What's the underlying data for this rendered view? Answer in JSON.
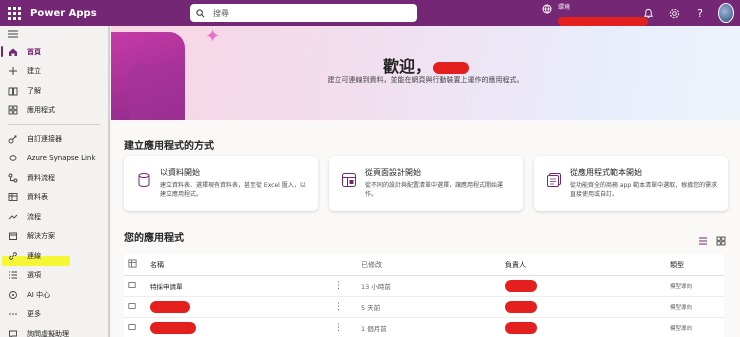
{
  "topbar": {
    "brand": "Power Apps",
    "search_placeholder": "搜尋",
    "environment_label": "環境"
  },
  "sidebar": {
    "items": [
      {
        "label": "首頁",
        "icon": "home-icon",
        "active": true
      },
      {
        "label": "建立",
        "icon": "plus-icon"
      },
      {
        "label": "了解",
        "icon": "book-icon"
      },
      {
        "label": "應用程式",
        "icon": "apps-icon"
      },
      {
        "label": "自訂連接器",
        "icon": "connector-icon"
      },
      {
        "label": "Azure Synapse Link",
        "icon": "synapse-icon"
      },
      {
        "label": "資料流程",
        "icon": "dataflow-icon"
      },
      {
        "label": "資料表",
        "icon": "table-icon"
      },
      {
        "label": "流程",
        "icon": "flow-icon"
      },
      {
        "label": "解決方案",
        "icon": "solution-icon"
      },
      {
        "label": "連線",
        "icon": "link-icon"
      },
      {
        "label": "選項",
        "icon": "options-icon"
      },
      {
        "label": "AI 中心",
        "icon": "ai-icon"
      },
      {
        "label": "更多",
        "icon": "more-icon"
      },
      {
        "label": "詢問虛擬助理",
        "icon": "chat-icon"
      }
    ]
  },
  "hero": {
    "title": "歡迎，",
    "subtitle": "建立可連線到資料，並能在網頁與行動裝置上運作的應用程式。"
  },
  "build": {
    "title": "建立應用程式的方式",
    "cards": [
      {
        "title": "以資料開始",
        "desc": "建立資料表、選擇現有資料表，甚至從 Excel 匯入，以建立應用程式。"
      },
      {
        "title": "從頁面設計開始",
        "desc": "從不同的設計與配置清單中選擇，讓應用程式開始運作。"
      },
      {
        "title": "從應用程式範本開始",
        "desc": "從功能齊全的商務 app 範本清單中選取，根據您的需求直接使用或自訂。"
      }
    ]
  },
  "apps": {
    "title": "您的應用程式",
    "columns": [
      "名稱",
      "已修改",
      "負責人",
      "類型"
    ],
    "rows": [
      {
        "name": "特採申請單",
        "modified": "13 小時前",
        "type": "模型導向"
      },
      {
        "name": "",
        "modified": "5 天前",
        "type": "模型導向"
      },
      {
        "name": "",
        "modified": "1 個月前",
        "type": "模型導向"
      }
    ]
  },
  "colors": {
    "brand": "#742774",
    "redaction": "#e4201e",
    "highlight": "#f4f52b"
  }
}
